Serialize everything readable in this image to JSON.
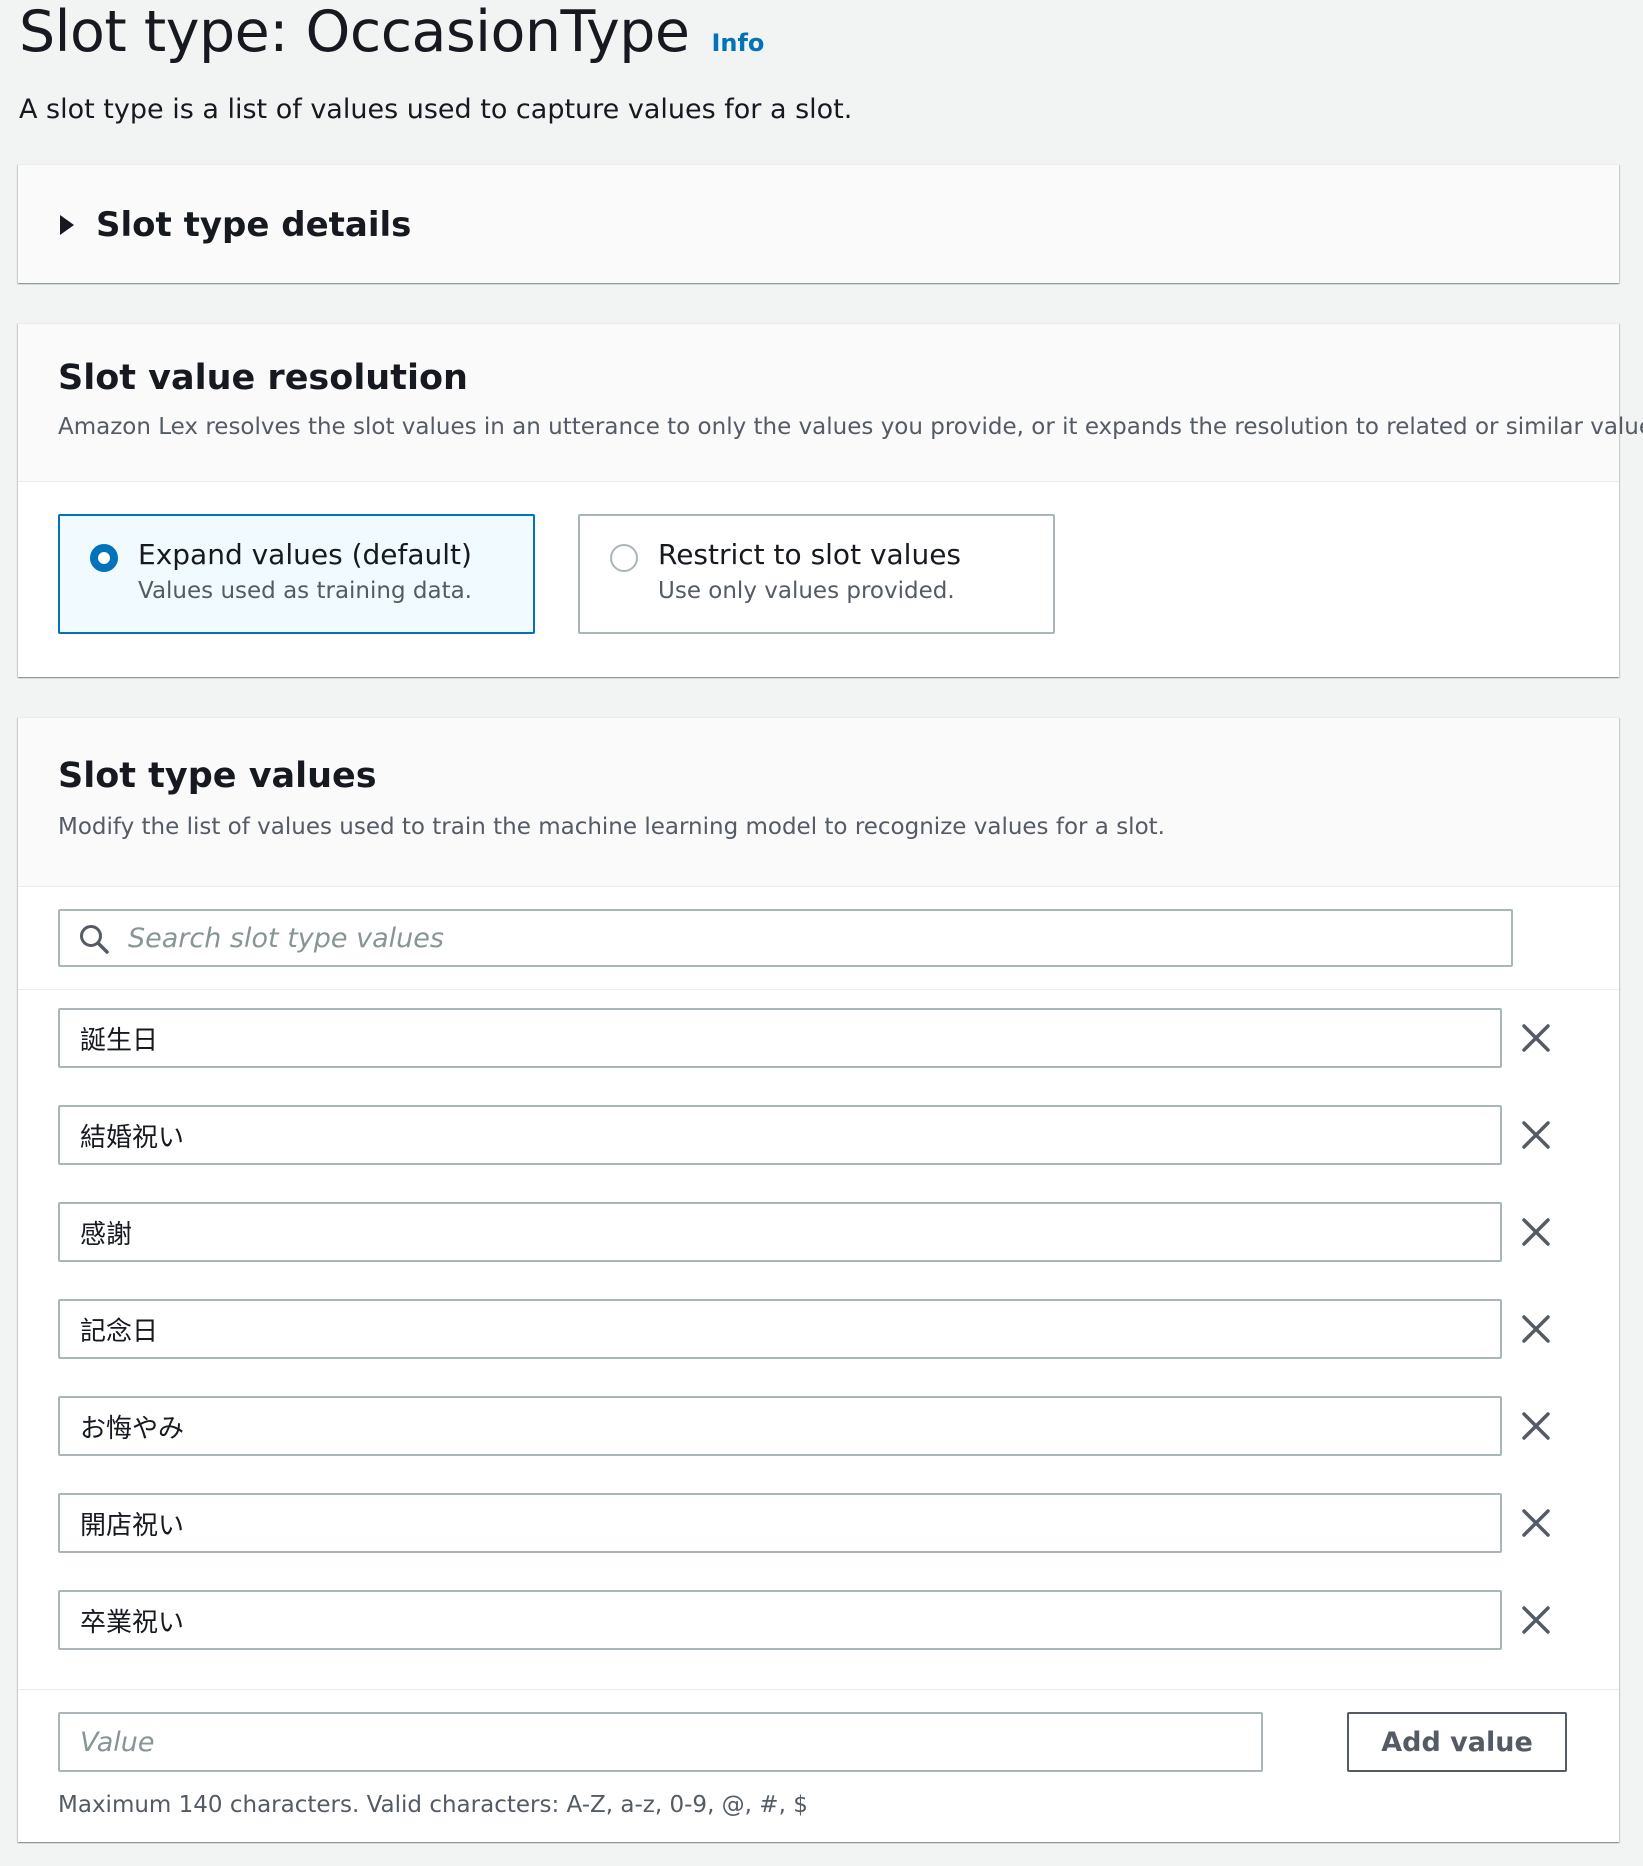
{
  "header": {
    "title": "Slot type: OccasionType",
    "info_label": "Info",
    "description": "A slot type is a list of values used to capture values for a slot."
  },
  "details_panel": {
    "label": "Slot type details",
    "expanded": false
  },
  "resolution_panel": {
    "title": "Slot value resolution",
    "description": "Amazon Lex resolves the slot values in an utterance to only the values you provide, or it expands the resolution to related or similar values.",
    "options": [
      {
        "label": "Expand values (default)",
        "description": "Values used as training data.",
        "selected": true
      },
      {
        "label": "Restrict to slot values",
        "description": "Use only values provided.",
        "selected": false
      }
    ]
  },
  "values_panel": {
    "title": "Slot type values",
    "description": "Modify the list of values used to train the machine learning model to recognize values for a slot.",
    "search_placeholder": "Search slot type values",
    "values": [
      "誕生日",
      "結婚祝い",
      "感謝",
      "記念日",
      "お悔やみ",
      "開店祝い",
      "卒業祝い"
    ],
    "new_value_placeholder": "Value",
    "add_button_label": "Add value",
    "constraint_text": "Maximum 140 characters. Valid characters: A-Z, a-z, 0-9, @, #, $"
  },
  "colors": {
    "accent": "#0073bb",
    "background": "#f2f3f3",
    "border": "#aab7b8",
    "secondary_text": "#545b64"
  },
  "icons": {
    "search": "search-icon",
    "remove": "close-icon",
    "expander": "caret-right-icon"
  }
}
